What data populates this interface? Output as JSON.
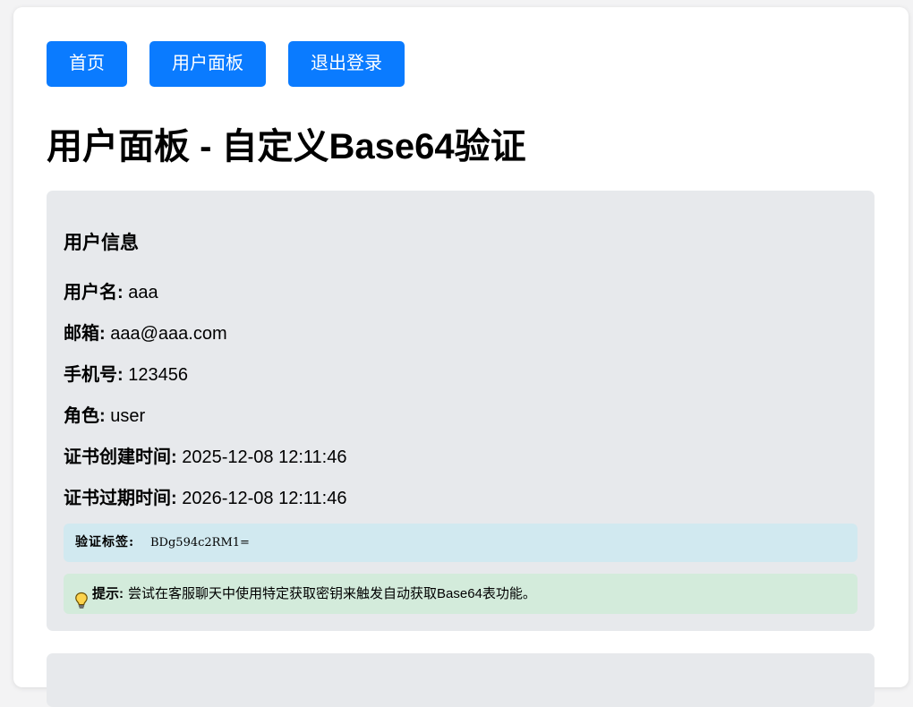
{
  "nav": {
    "home": "首页",
    "dashboard": "用户面板",
    "logout": "退出登录"
  },
  "page_title": "用户面板 - 自定义Base64验证",
  "user_info": {
    "title": "用户信息",
    "fields": [
      {
        "label": "用户名:",
        "value": "aaa"
      },
      {
        "label": "邮箱:",
        "value": "aaa@aaa.com"
      },
      {
        "label": "手机号:",
        "value": "123456"
      },
      {
        "label": "角色:",
        "value": "user"
      },
      {
        "label": "证书创建时间:",
        "value": "2025-12-08 12:11:46"
      },
      {
        "label": "证书过期时间:",
        "value": "2026-12-08 12:11:46"
      }
    ],
    "signature": {
      "label": "验证标签:",
      "value": "BDg594c2RM1="
    },
    "tip": {
      "icon": "lightbulb-icon",
      "label": "提示:",
      "text": "尝试在客服聊天中使用特定获取密钥来触发自动获取Base64表功能。"
    }
  },
  "colors": {
    "primary": "#0a7bff",
    "panel": "#e7e9ec",
    "info_box": "#d1e9f0",
    "tip_box": "#d3ebdb"
  }
}
